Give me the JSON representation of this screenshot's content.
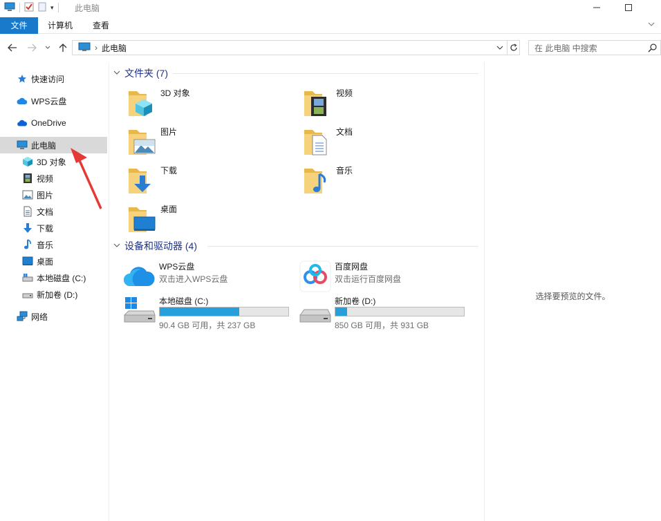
{
  "window": {
    "title": "此电脑"
  },
  "ribbon": {
    "tabs": [
      "文件",
      "计算机",
      "查看"
    ]
  },
  "address": {
    "crumb": "此电脑",
    "search_placeholder": "在 此电脑 中搜索"
  },
  "nav": {
    "items": [
      {
        "label": "快速访问",
        "icon": "star-icon"
      },
      {
        "label": "WPS云盘",
        "icon": "cloud-icon"
      },
      {
        "label": "OneDrive",
        "icon": "onedrive-icon"
      },
      {
        "label": "此电脑",
        "icon": "computer-icon"
      },
      {
        "label": "3D 对象",
        "icon": "cube-icon"
      },
      {
        "label": "视频",
        "icon": "film-icon"
      },
      {
        "label": "图片",
        "icon": "picture-icon"
      },
      {
        "label": "文档",
        "icon": "document-icon"
      },
      {
        "label": "下载",
        "icon": "download-icon"
      },
      {
        "label": "音乐",
        "icon": "music-icon"
      },
      {
        "label": "桌面",
        "icon": "desktop-icon"
      },
      {
        "label": "本地磁盘 (C:)",
        "icon": "drive-icon"
      },
      {
        "label": "新加卷 (D:)",
        "icon": "drive-icon"
      },
      {
        "label": "网络",
        "icon": "network-icon"
      }
    ]
  },
  "groups": {
    "folders_header": "文件夹 (7)",
    "devices_header": "设备和驱动器 (4)"
  },
  "folders": [
    {
      "label": "3D 对象"
    },
    {
      "label": "视频"
    },
    {
      "label": "图片"
    },
    {
      "label": "文档"
    },
    {
      "label": "下载"
    },
    {
      "label": "音乐"
    },
    {
      "label": "桌面"
    }
  ],
  "devices": [
    {
      "name": "WPS云盘",
      "sub": "双击进入WPS云盘"
    },
    {
      "name": "百度网盘",
      "sub": "双击运行百度网盘"
    },
    {
      "name": "本地磁盘 (C:)",
      "free": "90.4 GB 可用，共 237 GB",
      "used_fraction": 0.62
    },
    {
      "name": "新加卷 (D:)",
      "free": "850 GB 可用，共 931 GB",
      "used_fraction": 0.09
    }
  ],
  "preview": {
    "message": "选择要预览的文件。"
  },
  "colors": {
    "accent": "#1979ca",
    "bar_fill": "#26a0da",
    "header_text": "#1e3287",
    "arrow": "#e53935"
  }
}
